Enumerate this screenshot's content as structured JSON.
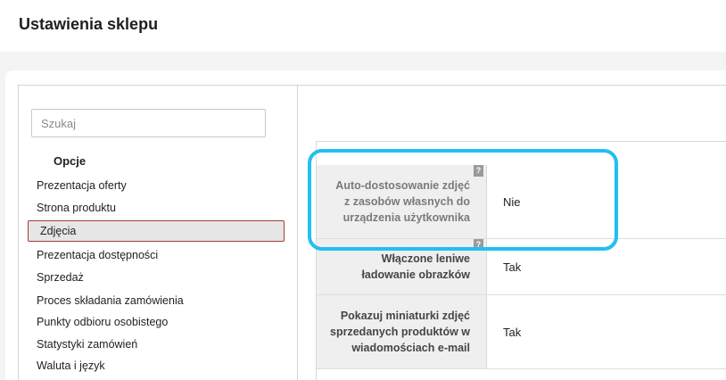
{
  "header": {
    "title": "Ustawienia sklepu"
  },
  "sidebar": {
    "search_placeholder": "Szukaj",
    "section_title": "Opcje",
    "items": [
      {
        "label": "Prezentacja oferty"
      },
      {
        "label": "Strona produktu"
      },
      {
        "label": "Zdjęcia",
        "active": true
      },
      {
        "label": "Prezentacja dostępności"
      },
      {
        "label": "Sprzedaż"
      },
      {
        "label": "Proces składania zamówienia"
      },
      {
        "label": "Punkty odbioru osobistego"
      },
      {
        "label": "Statystyki zamówień"
      },
      {
        "label": "Waluta i język"
      }
    ]
  },
  "settings": {
    "help_icon": "?",
    "rows": [
      {
        "label": "Auto-dostosowanie zdjęć z zasobów własnych do urządzenia użytkownika",
        "value": "Nie"
      },
      {
        "label": "Włączone leniwe ładowanie obrazków",
        "value": "Tak"
      },
      {
        "label": "Pokazuj miniaturki zdjęć sprzedanych produktów w wiadomościach e-mail",
        "value": "Tak"
      }
    ]
  },
  "colors": {
    "highlight": "#21bff2",
    "active_border": "#a63a3a"
  }
}
